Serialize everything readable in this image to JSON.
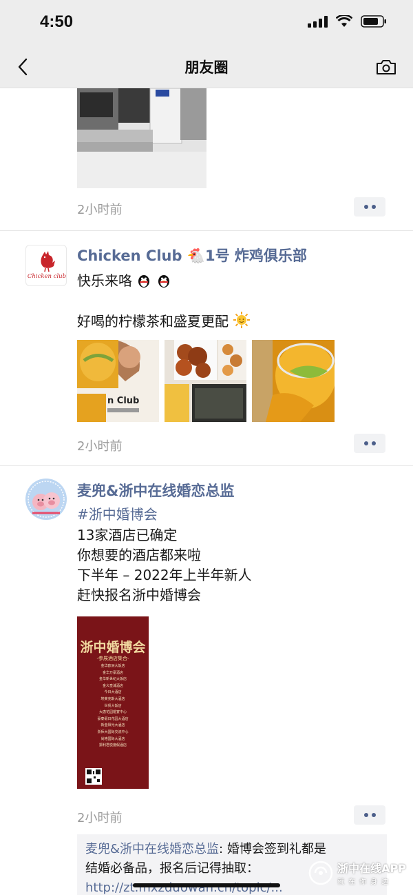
{
  "status_bar": {
    "time": "4:50"
  },
  "nav": {
    "title": "朋友圈"
  },
  "posts": [
    {
      "time": "2小时前"
    },
    {
      "nickname": "Chicken Club 🐔1号 炸鸡俱乐部",
      "lines": [
        "快乐来咯",
        "好喝的柠檬茶和盛夏更配"
      ],
      "avatar_text": "Chicken club",
      "photo_caption": "n Club",
      "time": "2小时前"
    },
    {
      "nickname": "麦兜&浙中在线婚恋总监",
      "topic": "#浙中婚博会",
      "lines": [
        "13家酒店已确定",
        "你想要的酒店都来啦",
        "下半年 – 2022年上半年新人",
        "赶快报名浙中婚博会"
      ],
      "poster": {
        "title": "浙中婚博会",
        "subtitle": "-参展酒店集合-",
        "hotels": [
          "金华欧洲大饭店",
          "金华万豪酒店",
          "金华新世纪大饭店",
          "金义皇浦酒店",
          "今日大酒店",
          "埃莱克斯大酒店",
          "世贸大饭店",
          "大唐花园婚宴中心",
          "豪泰假日花园大酒店",
          "新金阳光大酒店",
          "浙师大国际交流中心",
          "尚格国际大酒店",
          "振利君悦度假酒店"
        ]
      },
      "time": "2小时前",
      "comment": {
        "name": "麦兜&浙中在线婚恋总监",
        "text_1": ": 婚博会签到礼都是",
        "text_2": "结婚必备品，报名后记得抽取：",
        "link": "http://zt.mxzduowan.cn/topic/..."
      }
    }
  ],
  "watermark": {
    "title": "浙中在线APP",
    "subtitle": "就在你身边"
  },
  "colors": {
    "link": "#576b95",
    "nav_bg": "#ededed",
    "poster_bg": "#7a1418"
  }
}
